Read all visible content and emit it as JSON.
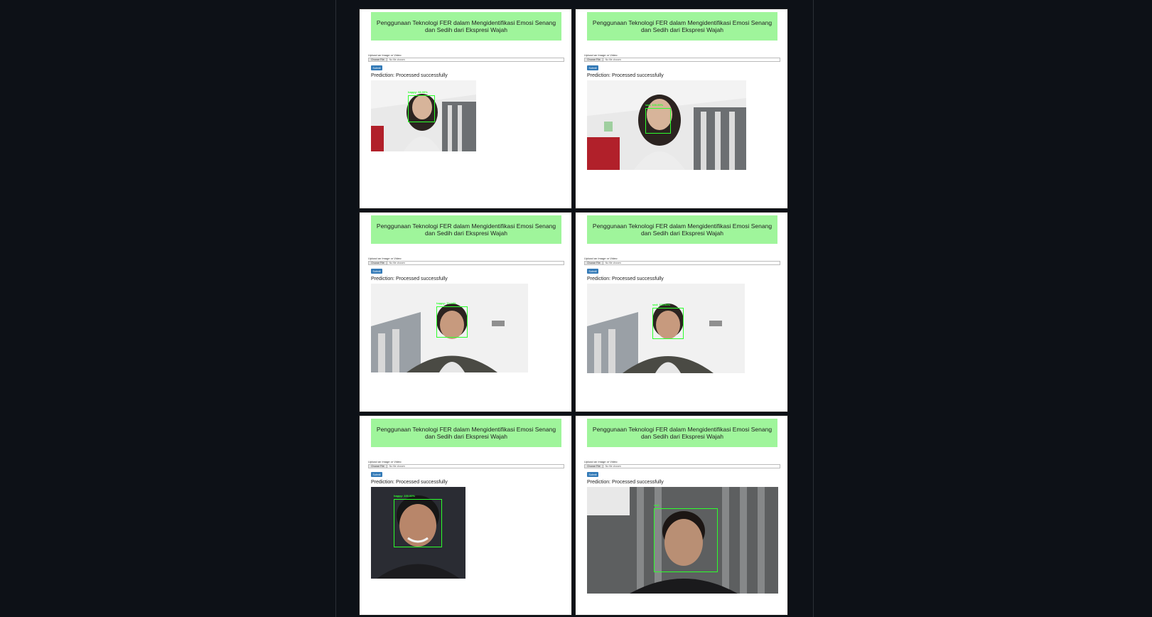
{
  "banner_title": "Penggunaan Teknologi FER dalam Mengidentifikasi Emosi Senang dan Sedih dari Ekspresi Wajah",
  "upload_label": "Upload an Image or Video:",
  "choose_file_label": "Choose File",
  "no_file_label": "No file chosen",
  "submit_label": "Submit",
  "prediction_text": "Prediction: Processed successfully",
  "panels": [
    {
      "detection_label": "happy: 98.99%",
      "scene": "office-girl"
    },
    {
      "detection_label": "sad: 100.00%",
      "scene": "office-girl"
    },
    {
      "detection_label": "happy: 72.14%",
      "scene": "office-boy"
    },
    {
      "detection_label": "sad: 100.00%",
      "scene": "office-boy"
    },
    {
      "detection_label": "happy: 100.00%",
      "scene": "dark-man"
    },
    {
      "detection_label": "sad",
      "scene": "stripes-man"
    }
  ],
  "colors": {
    "banner": "#9ff59b",
    "detection": "#2cff2c",
    "submit": "#337ab7",
    "background": "#0d1117"
  }
}
